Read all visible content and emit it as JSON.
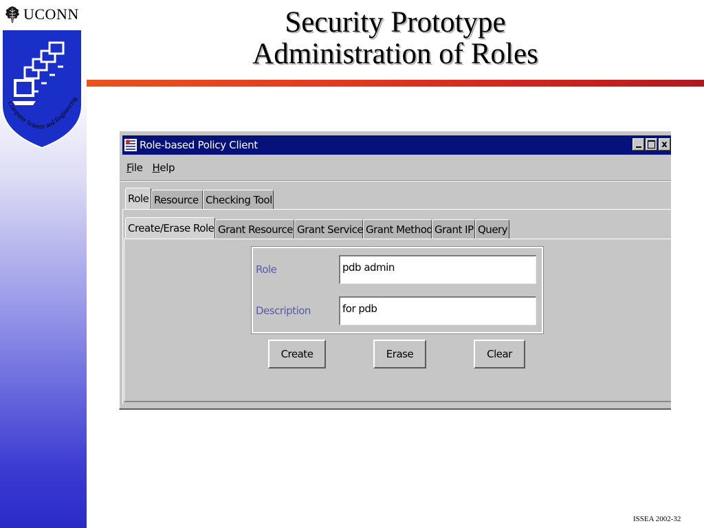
{
  "slide": {
    "title_line1": "Security Prototype",
    "title_line2": "Administration of Roles",
    "footer": "ISSEA 2002-32",
    "logo_text": "UCONN",
    "shield_text": "Computer Science and Engineering",
    "accent_color": "#d42a1f",
    "stripe_color": "#2a2ac8"
  },
  "window": {
    "title": "Role-based Policy Client",
    "title_color": "#06127a",
    "controls": [
      "minimize-icon",
      "maximize-icon",
      "close-icon"
    ],
    "close_glyph": "x"
  },
  "menu": {
    "file_ul": "F",
    "file_rest": "ile",
    "help_ul": "H",
    "help_rest": "elp"
  },
  "main_tabs": [
    "Role",
    "Resource",
    "Checking Tool"
  ],
  "sub_tabs": [
    "Create/Erase Role",
    "Grant Resource",
    "Grant Service",
    "Grant Method",
    "Grant IP",
    "Query"
  ],
  "form": {
    "role_label": "Role",
    "role_value": "pdb admin",
    "description_label": "Description",
    "description_value": "for pdb"
  },
  "buttons": {
    "create": "Create",
    "erase": "Erase",
    "clear": "Clear"
  }
}
